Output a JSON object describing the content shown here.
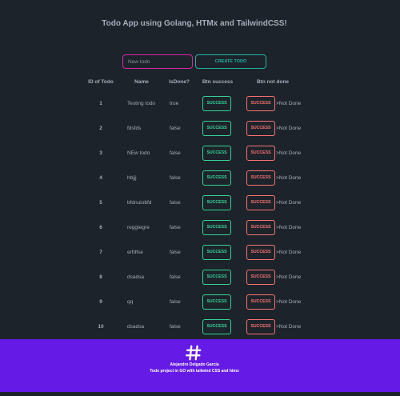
{
  "app": {
    "title": "Todo App using Golang, HTMx and TailwindCSS!"
  },
  "form": {
    "placeholder": "New todo",
    "value": "",
    "create_label": "CREATE TODO"
  },
  "table": {
    "headers": [
      "ID of Todo",
      "Name",
      "IsDone?",
      "Btn success",
      "Btn not done"
    ],
    "rows": [
      {
        "id": "1",
        "name": "Testing todo",
        "done": "true",
        "success_label": "SUCCESS",
        "notdone_label": "SUCCESS",
        "notdone_text": ">Not Done"
      },
      {
        "id": "2",
        "name": "fdsfds",
        "done": "false",
        "success_label": "SUCCESS",
        "notdone_label": "SUCCESS",
        "notdone_text": ">Not Done"
      },
      {
        "id": "3",
        "name": "NEw todo",
        "done": "false",
        "success_label": "SUCCESS",
        "notdone_label": "SUCCESS",
        "notdone_text": ">Not Done"
      },
      {
        "id": "4",
        "name": "hbjjj",
        "done": "false",
        "success_label": "SUCCESS",
        "notdone_label": "SUCCESS",
        "notdone_text": ">Not Done"
      },
      {
        "id": "5",
        "name": "bfdnuiobfd",
        "done": "false",
        "success_label": "SUCCESS",
        "notdone_label": "SUCCESS",
        "notdone_text": ">Not Done"
      },
      {
        "id": "6",
        "name": "reggtegre",
        "done": "false",
        "success_label": "SUCCESS",
        "notdone_label": "SUCCESS",
        "notdone_text": ">Not Done"
      },
      {
        "id": "7",
        "name": "erfdfse",
        "done": "false",
        "success_label": "SUCCESS",
        "notdone_label": "SUCCESS",
        "notdone_text": ">Not Done"
      },
      {
        "id": "8",
        "name": "dsadsa",
        "done": "false",
        "success_label": "SUCCESS",
        "notdone_label": "SUCCESS",
        "notdone_text": ">Not Done"
      },
      {
        "id": "9",
        "name": "qq",
        "done": "false",
        "success_label": "SUCCESS",
        "notdone_label": "SUCCESS",
        "notdone_text": ">Not Done"
      },
      {
        "id": "10",
        "name": "dsadsa",
        "done": "false",
        "success_label": "SUCCESS",
        "notdone_label": "SUCCESS",
        "notdone_text": ">Not Done"
      }
    ]
  },
  "footer": {
    "icon": "hashtag-icon",
    "author": "Alejandro Delgado García",
    "description": "Todo project in GO with tailwind CSS and htmx"
  },
  "colors": {
    "background": "#1d232a",
    "text": "#a6adbb",
    "input_border": "#d926a9",
    "create_button": "#1fb2a6",
    "success": "#36d399",
    "error": "#f87272",
    "footer": "#661ae6"
  }
}
